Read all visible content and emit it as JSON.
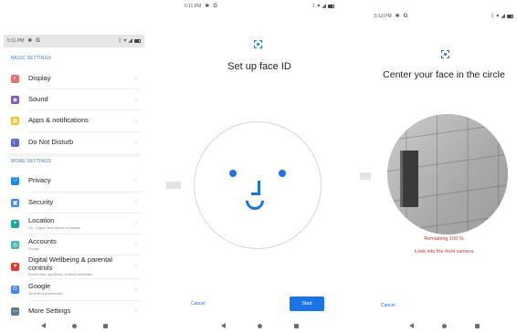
{
  "screen1": {
    "status": {
      "time": "5:11 PM"
    },
    "basic_settings_title": "BASIC SETTINGS",
    "more_settings_title": "MORE SETTINGS",
    "items": [
      {
        "label": "Display",
        "sub": "",
        "icon": "display-icon",
        "color": "#e57373"
      },
      {
        "label": "Sound",
        "sub": "",
        "icon": "sound-icon",
        "color": "#7e57c2"
      },
      {
        "label": "Apps & notifications",
        "sub": "",
        "icon": "apps-icon",
        "color": "#f6bf26"
      },
      {
        "label": "Do Not Disturb",
        "sub": "",
        "icon": "moon-icon",
        "color": "#5c6bc0"
      },
      {
        "label": "Privacy",
        "sub": "",
        "icon": "privacy-icon",
        "color": "#1e88e5"
      },
      {
        "label": "Security",
        "sub": "",
        "icon": "lock-icon",
        "color": "#4285f4"
      },
      {
        "label": "Location",
        "sub": "On - 3 apps have access to location",
        "icon": "location-icon",
        "color": "#26a69a"
      },
      {
        "label": "Accounts",
        "sub": "Google",
        "icon": "accounts-icon",
        "color": "#4db6ac"
      },
      {
        "label": "Digital Wellbeing & parental controls",
        "sub": "Screen time, app timers, bedtime schedules",
        "icon": "wellbeing-icon",
        "color": "#e53935"
      },
      {
        "label": "Google",
        "sub": "Services & preferences",
        "icon": "google-icon",
        "color": "#4285f4"
      },
      {
        "label": "More Settings",
        "sub": "",
        "icon": "more-icon",
        "color": "#607d8b"
      }
    ]
  },
  "screen2": {
    "status": {
      "time": "5:11 PM"
    },
    "heading": "Set up face ID",
    "cancel_label": "Cancel",
    "start_label": "Start"
  },
  "screen3": {
    "status": {
      "time": "5:13 PM"
    },
    "heading": "Center your face in the circle",
    "remaining": "Remaining 100 %",
    "hint": "Look into the front camera",
    "cancel_label": "Cancel"
  },
  "colors": {
    "accent": "#1a73e8",
    "warning": "#d93025"
  }
}
